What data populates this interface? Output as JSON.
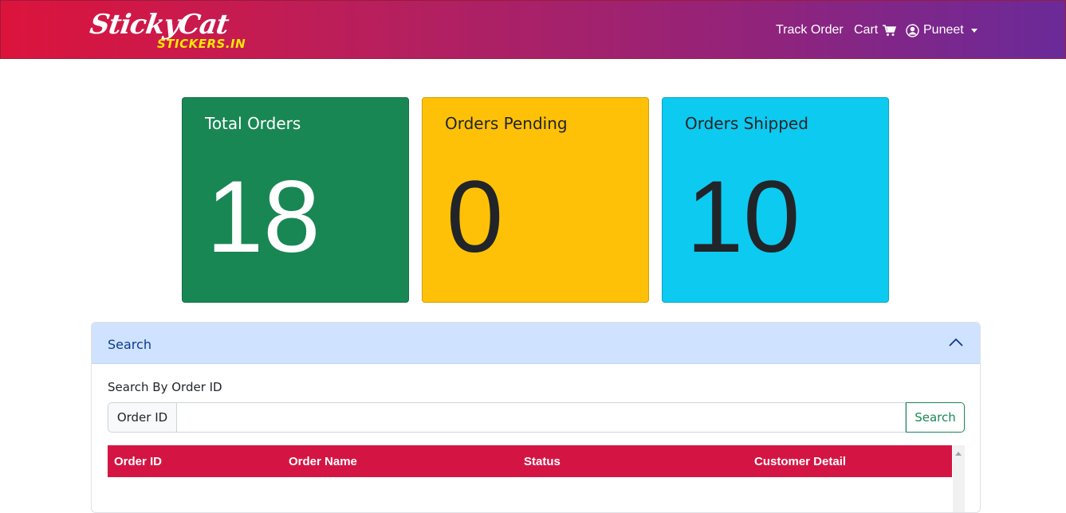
{
  "brand": {
    "script": "StickyCat",
    "sub": "STICKERS.IN"
  },
  "nav": {
    "track_order": "Track Order",
    "cart": "Cart",
    "user": "Puneet"
  },
  "stats": [
    {
      "title": "Total Orders",
      "value": "18",
      "color": "#198754"
    },
    {
      "title": "Orders Pending",
      "value": "0",
      "color": "#ffc107"
    },
    {
      "title": "Orders Shipped",
      "value": "10",
      "color": "#0dcaf0"
    }
  ],
  "search_panel": {
    "header": "Search",
    "label": "Search By Order ID",
    "prefix": "Order ID",
    "input_value": "",
    "button": "Search"
  },
  "table": {
    "columns": [
      "Order ID",
      "Order Name",
      "Status",
      "Customer Detail"
    ],
    "header_color": "#d41543",
    "rows": []
  },
  "colors": {
    "nav_gradient_start": "#dc143c",
    "nav_gradient_end": "#6a2a99",
    "logo_accent": "#ffe600"
  }
}
